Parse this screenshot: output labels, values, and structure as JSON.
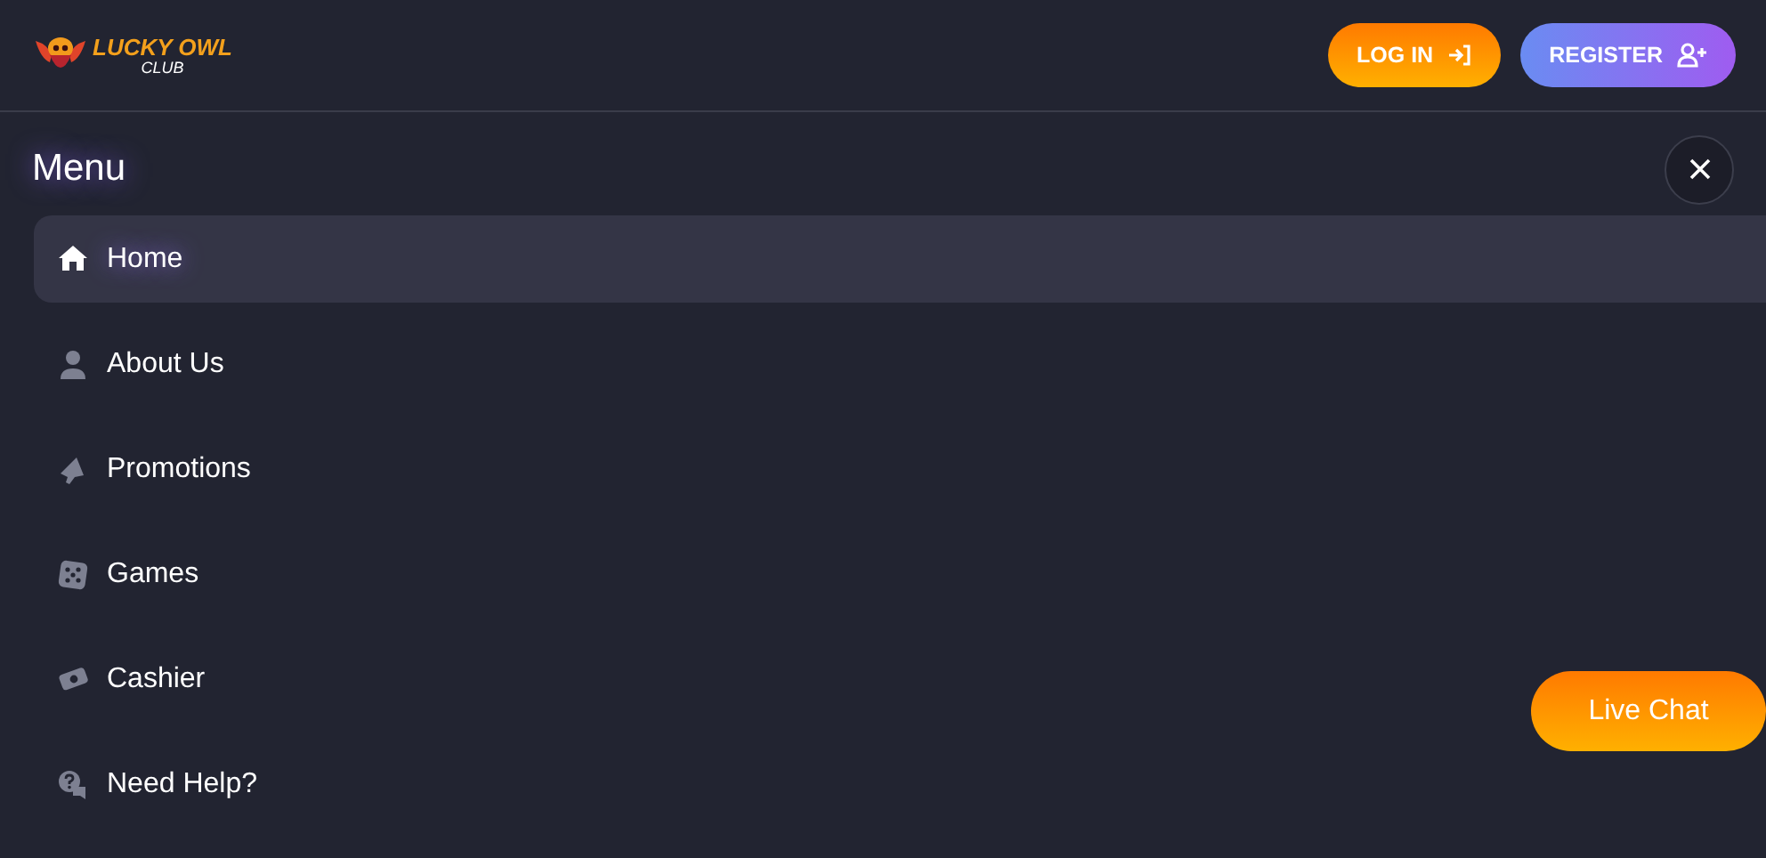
{
  "header": {
    "logo": {
      "name": "LUCKY OWL",
      "sub": "CLUB"
    },
    "buttons": [
      {
        "label": "LOG IN",
        "kind": "login"
      },
      {
        "label": "REGISTER",
        "kind": "register"
      }
    ]
  },
  "menu": {
    "title": "Menu",
    "items": [
      {
        "label": "Home",
        "kind": "home",
        "selected": true
      },
      {
        "label": "About Us",
        "kind": "about",
        "selected": false
      },
      {
        "label": "Promotions",
        "kind": "promo",
        "selected": false
      },
      {
        "label": "Games",
        "kind": "games",
        "selected": false
      },
      {
        "label": "Cashier",
        "kind": "cashier",
        "selected": false
      },
      {
        "label": "Need Help?",
        "kind": "help",
        "selected": false
      }
    ]
  },
  "live_chat": {
    "label": "Live Chat"
  }
}
